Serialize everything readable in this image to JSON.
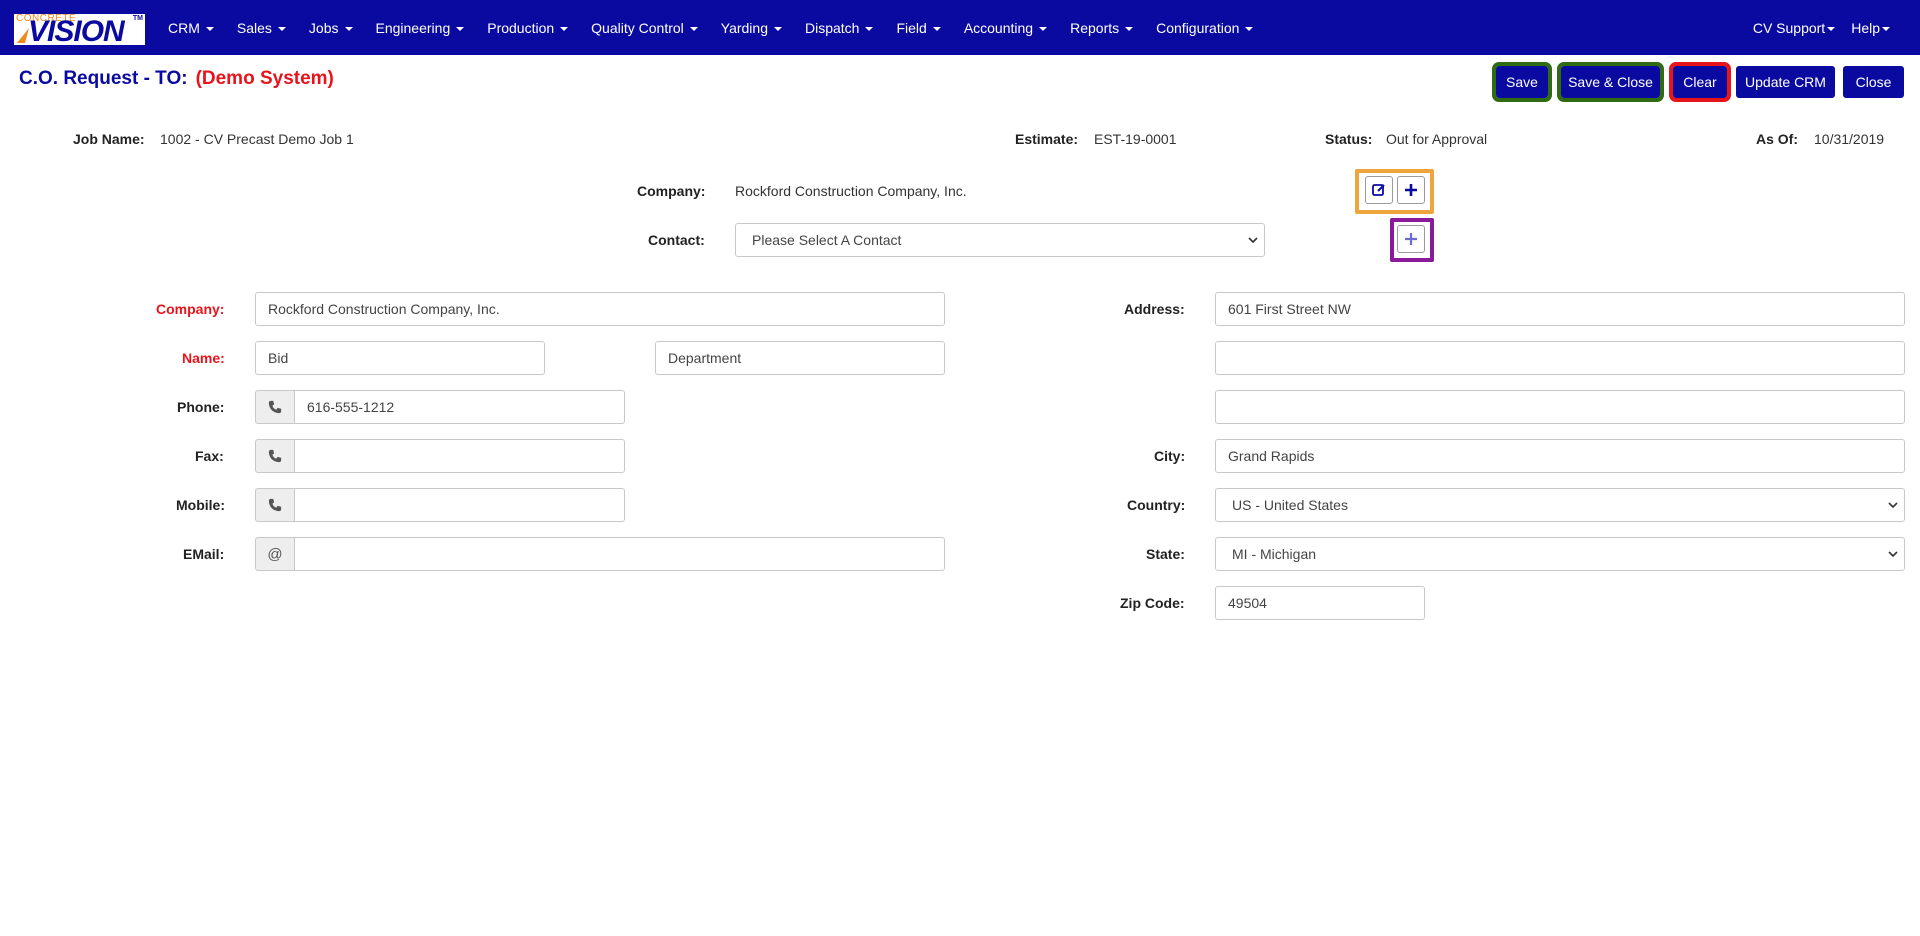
{
  "brand": {
    "logo_small": "CONCRETE",
    "logo_big": "VISION",
    "logo_tm": "TM"
  },
  "nav": {
    "items": [
      "CRM",
      "Sales",
      "Jobs",
      "Engineering",
      "Production",
      "Quality Control",
      "Yarding",
      "Dispatch",
      "Field",
      "Accounting",
      "Reports",
      "Configuration"
    ],
    "right": [
      "CV Support",
      "Help"
    ]
  },
  "header": {
    "title": "C.O. Request - TO:",
    "subtitle": "(Demo System)",
    "buttons": {
      "save": "Save",
      "save_close": "Save & Close",
      "clear": "Clear",
      "update_crm": "Update CRM",
      "close": "Close"
    }
  },
  "info": {
    "job_name_label": "Job Name:",
    "job_name": "1002 - CV Precast Demo Job 1",
    "estimate_label": "Estimate:",
    "estimate": "EST-19-0001",
    "status_label": "Status:",
    "status": "Out for Approval",
    "as_of_label": "As Of:",
    "as_of": "10/31/2019"
  },
  "lookup": {
    "company_label": "Company:",
    "company": "Rockford Construction Company, Inc.",
    "contact_label": "Contact:",
    "contact_selected": "Please Select A Contact"
  },
  "form": {
    "company_label": "Company:",
    "company": "Rockford Construction Company, Inc.",
    "name_label": "Name:",
    "first_name": "Bid",
    "department": "Department",
    "phone_label": "Phone:",
    "phone": "616-555-1212",
    "fax_label": "Fax:",
    "fax": "",
    "mobile_label": "Mobile:",
    "mobile": "",
    "email_label": "EMail:",
    "email_addon": "@",
    "email": "",
    "address_label": "Address:",
    "address1": "601 First Street NW",
    "address2": "",
    "address3": "",
    "city_label": "City:",
    "city": "Grand Rapids",
    "country_label": "Country:",
    "country": "US - United States",
    "state_label": "State:",
    "state": "MI - Michigan",
    "zip_label": "Zip Code:",
    "zip": "49504"
  },
  "colors": {
    "navbar": "#0a0aa0",
    "accent_red": "#e8141c",
    "highlight_green": "#2f6b12",
    "highlight_orange": "#f0a53c",
    "highlight_purple": "#8a1a9a"
  }
}
